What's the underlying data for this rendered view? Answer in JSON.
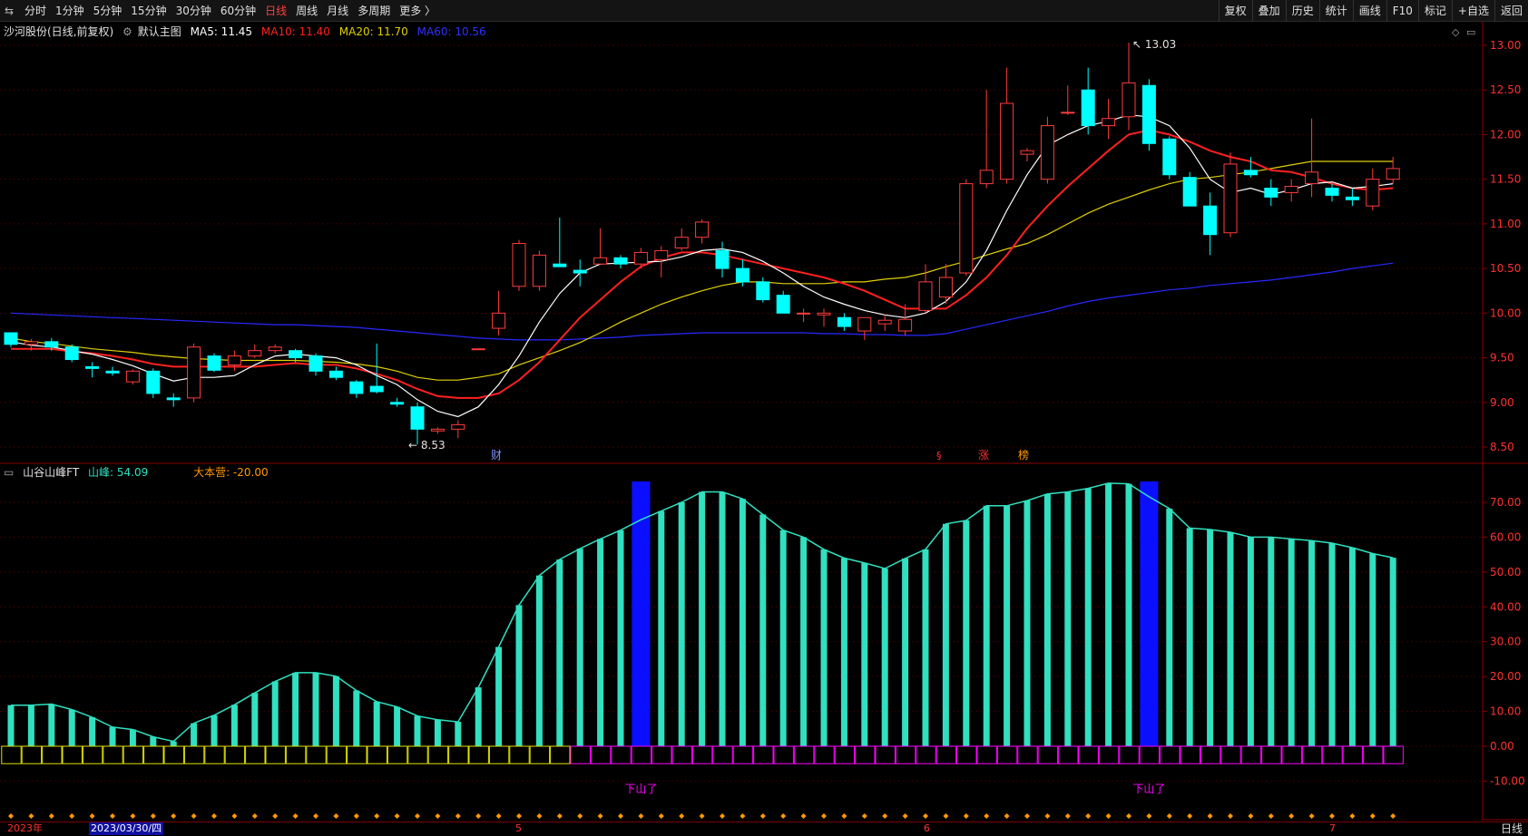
{
  "toolbar": {
    "nav_icon": "⇆",
    "periods": [
      "分时",
      "1分钟",
      "5分钟",
      "15分钟",
      "30分钟",
      "60分钟",
      "日线",
      "周线",
      "月线",
      "多周期",
      "更多 〉"
    ],
    "active_period": "日线",
    "right_buttons": [
      "复权",
      "叠加",
      "历史",
      "统计",
      "画线",
      "F10",
      "标记",
      "+自选",
      "返回"
    ]
  },
  "main_info": {
    "stock": "沙河股份(日线,前复权)",
    "template_icon": "gear-icon",
    "template": "默认主图",
    "ma5": "MA5: 11.45",
    "ma10": "MA10: 11.40",
    "ma20": "MA20: 11.70",
    "ma60": "MA60: 10.56"
  },
  "indicator_info": {
    "name": "山谷山峰FT",
    "value": "山峰: 54.09",
    "value2": "大本营: -20.00"
  },
  "colors": {
    "up": "#ff3c3c",
    "down": "#00ffff",
    "ma5": "#ffffff",
    "ma10": "#ff2020",
    "ma20": "#e0d000",
    "ma60": "#2828ff",
    "bar": "#30e0c0",
    "bar_highlight": "#0a10ff",
    "axis": "#8b0000",
    "magenta": "#ff00ff"
  },
  "price_axis": [
    "13.00",
    "12.50",
    "12.00",
    "11.50",
    "11.00",
    "10.50",
    "10.00",
    "9.50",
    "9.00",
    "8.50"
  ],
  "ind_axis": [
    "70.00",
    "60.00",
    "50.00",
    "40.00",
    "30.00",
    "20.00",
    "10.00",
    "0.00",
    "-10.00"
  ],
  "annotations": {
    "high": "13.03",
    "low": "8.53",
    "event_cai": "财",
    "event_s": "§",
    "event_zhang": "涨",
    "event_bang": "榜",
    "down_mountain": "下山了"
  },
  "x_axis": {
    "year": "2023年",
    "date_cursor": "2023/03/30/四",
    "m5": "5",
    "m6": "6",
    "m7": "7",
    "period": "日线"
  },
  "chart_data": {
    "type": "candlestick",
    "ohlc": [
      [
        9.78,
        9.72,
        9.62,
        9.65
      ],
      [
        9.65,
        9.71,
        9.58,
        9.68
      ],
      [
        9.68,
        9.72,
        9.58,
        9.62
      ],
      [
        9.62,
        9.65,
        9.45,
        9.48
      ],
      [
        9.4,
        9.45,
        9.28,
        9.38
      ],
      [
        9.35,
        9.4,
        9.3,
        9.33
      ],
      [
        9.23,
        9.37,
        9.2,
        9.35
      ],
      [
        9.35,
        9.38,
        9.05,
        9.1
      ],
      [
        9.05,
        9.1,
        8.95,
        9.03
      ],
      [
        9.05,
        9.66,
        9.0,
        9.62
      ],
      [
        9.52,
        9.55,
        9.34,
        9.36
      ],
      [
        9.42,
        9.58,
        9.35,
        9.52
      ],
      [
        9.52,
        9.65,
        9.5,
        9.58
      ],
      [
        9.58,
        9.65,
        9.55,
        9.62
      ],
      [
        9.58,
        9.6,
        9.45,
        9.5
      ],
      [
        9.52,
        9.55,
        9.3,
        9.35
      ],
      [
        9.35,
        9.4,
        9.25,
        9.28
      ],
      [
        9.23,
        9.25,
        9.05,
        9.1
      ],
      [
        9.18,
        9.66,
        9.1,
        9.12
      ],
      [
        9.0,
        9.05,
        8.95,
        8.98
      ],
      [
        8.95,
        9.0,
        8.53,
        8.7
      ],
      [
        8.68,
        8.72,
        8.65,
        8.7
      ],
      [
        8.7,
        8.8,
        8.6,
        8.75
      ],
      [
        9.6,
        9.6,
        9.6,
        9.6
      ],
      [
        9.83,
        10.25,
        9.75,
        10.0
      ],
      [
        10.3,
        10.82,
        10.25,
        10.78
      ],
      [
        10.3,
        10.7,
        10.25,
        10.65
      ],
      [
        10.55,
        11.07,
        10.55,
        10.52
      ],
      [
        10.48,
        10.6,
        10.3,
        10.45
      ],
      [
        10.55,
        10.95,
        10.55,
        10.62
      ],
      [
        10.62,
        10.65,
        10.5,
        10.55
      ],
      [
        10.55,
        10.73,
        10.5,
        10.68
      ],
      [
        10.6,
        10.75,
        10.4,
        10.7
      ],
      [
        10.73,
        10.95,
        10.7,
        10.85
      ],
      [
        10.85,
        11.05,
        10.78,
        11.02
      ],
      [
        10.7,
        10.8,
        10.4,
        10.5
      ],
      [
        10.5,
        10.6,
        10.3,
        10.35
      ],
      [
        10.35,
        10.4,
        10.12,
        10.15
      ],
      [
        10.2,
        10.25,
        10.0,
        10.0
      ],
      [
        10.0,
        10.05,
        9.9,
        10.0
      ],
      [
        9.98,
        10.05,
        9.85,
        10.0
      ],
      [
        9.95,
        10.0,
        9.8,
        9.85
      ],
      [
        9.8,
        9.95,
        9.7,
        9.95
      ],
      [
        9.88,
        9.98,
        9.8,
        9.92
      ],
      [
        9.8,
        10.1,
        9.75,
        9.93
      ],
      [
        10.03,
        10.55,
        10.0,
        10.35
      ],
      [
        10.18,
        10.55,
        10.1,
        10.4
      ],
      [
        10.45,
        11.5,
        10.42,
        11.45
      ],
      [
        11.45,
        12.5,
        11.4,
        11.6
      ],
      [
        11.5,
        12.75,
        11.45,
        12.35
      ],
      [
        11.78,
        11.85,
        11.7,
        11.82
      ],
      [
        11.5,
        12.2,
        11.45,
        12.1
      ],
      [
        12.25,
        12.55,
        12.22,
        12.25
      ],
      [
        12.5,
        12.75,
        12.0,
        12.1
      ],
      [
        12.1,
        12.4,
        11.95,
        12.18
      ],
      [
        12.2,
        13.03,
        12.05,
        12.58
      ],
      [
        12.55,
        12.62,
        11.82,
        11.9
      ],
      [
        11.95,
        11.98,
        11.5,
        11.55
      ],
      [
        11.52,
        11.58,
        11.2,
        11.2
      ],
      [
        11.2,
        11.35,
        10.65,
        10.88
      ],
      [
        10.9,
        11.8,
        10.85,
        11.67
      ],
      [
        11.6,
        11.75,
        11.52,
        11.55
      ],
      [
        11.4,
        11.5,
        11.2,
        11.3
      ],
      [
        11.35,
        11.5,
        11.25,
        11.42
      ],
      [
        11.45,
        12.18,
        11.3,
        11.58
      ],
      [
        11.4,
        11.45,
        11.25,
        11.32
      ],
      [
        11.3,
        11.4,
        11.2,
        11.27
      ],
      [
        11.2,
        11.62,
        11.15,
        11.5
      ],
      [
        11.5,
        11.75,
        11.45,
        11.62
      ]
    ],
    "ma5": [
      9.68,
      9.64,
      9.62,
      9.58,
      9.54,
      9.48,
      9.41,
      9.32,
      9.24,
      9.28,
      9.28,
      9.3,
      9.42,
      9.52,
      9.54,
      9.52,
      9.5,
      9.42,
      9.3,
      9.2,
      9.03,
      8.9,
      8.84,
      8.95,
      9.2,
      9.52,
      9.9,
      10.22,
      10.45,
      10.55,
      10.56,
      10.57,
      10.58,
      10.63,
      10.7,
      10.72,
      10.68,
      10.58,
      10.45,
      10.3,
      10.18,
      10.1,
      10.03,
      9.98,
      9.95,
      10.0,
      10.13,
      10.35,
      10.7,
      11.15,
      11.55,
      11.88,
      12.0,
      12.1,
      12.15,
      12.22,
      12.2,
      12.1,
      11.85,
      11.5,
      11.35,
      11.4,
      11.33,
      11.38,
      11.45,
      11.47,
      11.4,
      11.42,
      11.45
    ],
    "ma10": [
      9.6,
      9.6,
      9.6,
      9.57,
      9.55,
      9.52,
      9.48,
      9.43,
      9.4,
      9.4,
      9.4,
      9.4,
      9.4,
      9.42,
      9.44,
      9.42,
      9.42,
      9.38,
      9.32,
      9.25,
      9.15,
      9.07,
      9.05,
      9.05,
      9.1,
      9.25,
      9.45,
      9.7,
      9.95,
      10.15,
      10.35,
      10.52,
      10.62,
      10.68,
      10.68,
      10.65,
      10.6,
      10.55,
      10.5,
      10.45,
      10.4,
      10.33,
      10.25,
      10.15,
      10.05,
      10.05,
      10.05,
      10.2,
      10.4,
      10.65,
      10.95,
      11.2,
      11.42,
      11.62,
      11.82,
      12.0,
      12.05,
      12.0,
      11.92,
      11.82,
      11.75,
      11.7,
      11.6,
      11.58,
      11.52,
      11.45,
      11.4,
      11.38,
      11.4
    ],
    "ma20": [
      9.72,
      9.68,
      9.66,
      9.63,
      9.6,
      9.58,
      9.56,
      9.53,
      9.51,
      9.49,
      9.48,
      9.47,
      9.47,
      9.47,
      9.47,
      9.46,
      9.45,
      9.43,
      9.4,
      9.35,
      9.28,
      9.25,
      9.25,
      9.28,
      9.32,
      9.42,
      9.5,
      9.58,
      9.67,
      9.78,
      9.9,
      10.0,
      10.1,
      10.18,
      10.25,
      10.31,
      10.35,
      10.35,
      10.33,
      10.33,
      10.33,
      10.35,
      10.35,
      10.38,
      10.4,
      10.45,
      10.52,
      10.58,
      10.65,
      10.72,
      10.78,
      10.88,
      11.0,
      11.12,
      11.22,
      11.3,
      11.38,
      11.45,
      11.5,
      11.52,
      11.55,
      11.58,
      11.62,
      11.66,
      11.7,
      11.7,
      11.7,
      11.7,
      11.7
    ],
    "ma60": [
      10.0,
      9.99,
      9.98,
      9.97,
      9.96,
      9.95,
      9.94,
      9.93,
      9.92,
      9.91,
      9.9,
      9.89,
      9.88,
      9.87,
      9.87,
      9.86,
      9.85,
      9.84,
      9.82,
      9.8,
      9.78,
      9.76,
      9.74,
      9.72,
      9.71,
      9.7,
      9.7,
      9.7,
      9.71,
      9.72,
      9.73,
      9.75,
      9.76,
      9.77,
      9.78,
      9.78,
      9.78,
      9.78,
      9.78,
      9.78,
      9.77,
      9.77,
      9.76,
      9.76,
      9.75,
      9.75,
      9.77,
      9.82,
      9.87,
      9.92,
      9.97,
      10.02,
      10.08,
      10.13,
      10.17,
      10.2,
      10.23,
      10.26,
      10.28,
      10.31,
      10.33,
      10.35,
      10.37,
      10.4,
      10.43,
      10.46,
      10.5,
      10.53,
      10.56
    ],
    "mountain": [
      11.8,
      11.8,
      12.1,
      10.5,
      8.3,
      5.5,
      4.8,
      2.7,
      1.4,
      6.6,
      8.9,
      11.9,
      15.3,
      18.6,
      21.1,
      21.1,
      20.1,
      16.0,
      12.8,
      11.3,
      8.7,
      7.6,
      7.0,
      16.9,
      28.5,
      40.5,
      49.0,
      53.6,
      56.7,
      59.5,
      62.0,
      65.0,
      67.5,
      70.0,
      73.0,
      73.0,
      71.0,
      66.5,
      62.0,
      60.0,
      56.5,
      54.0,
      52.6,
      51.0,
      53.9,
      56.5,
      63.8,
      64.8,
      69.0,
      69.0,
      70.5,
      72.4,
      73.0,
      74.0,
      75.5,
      75.3,
      71.6,
      68.2,
      62.6,
      62.2,
      61.4,
      60.0,
      60.0,
      59.5,
      59.0,
      58.3,
      57.0,
      55.3,
      54.09
    ],
    "highlight": [
      31,
      56
    ],
    "camp": -20.0
  }
}
